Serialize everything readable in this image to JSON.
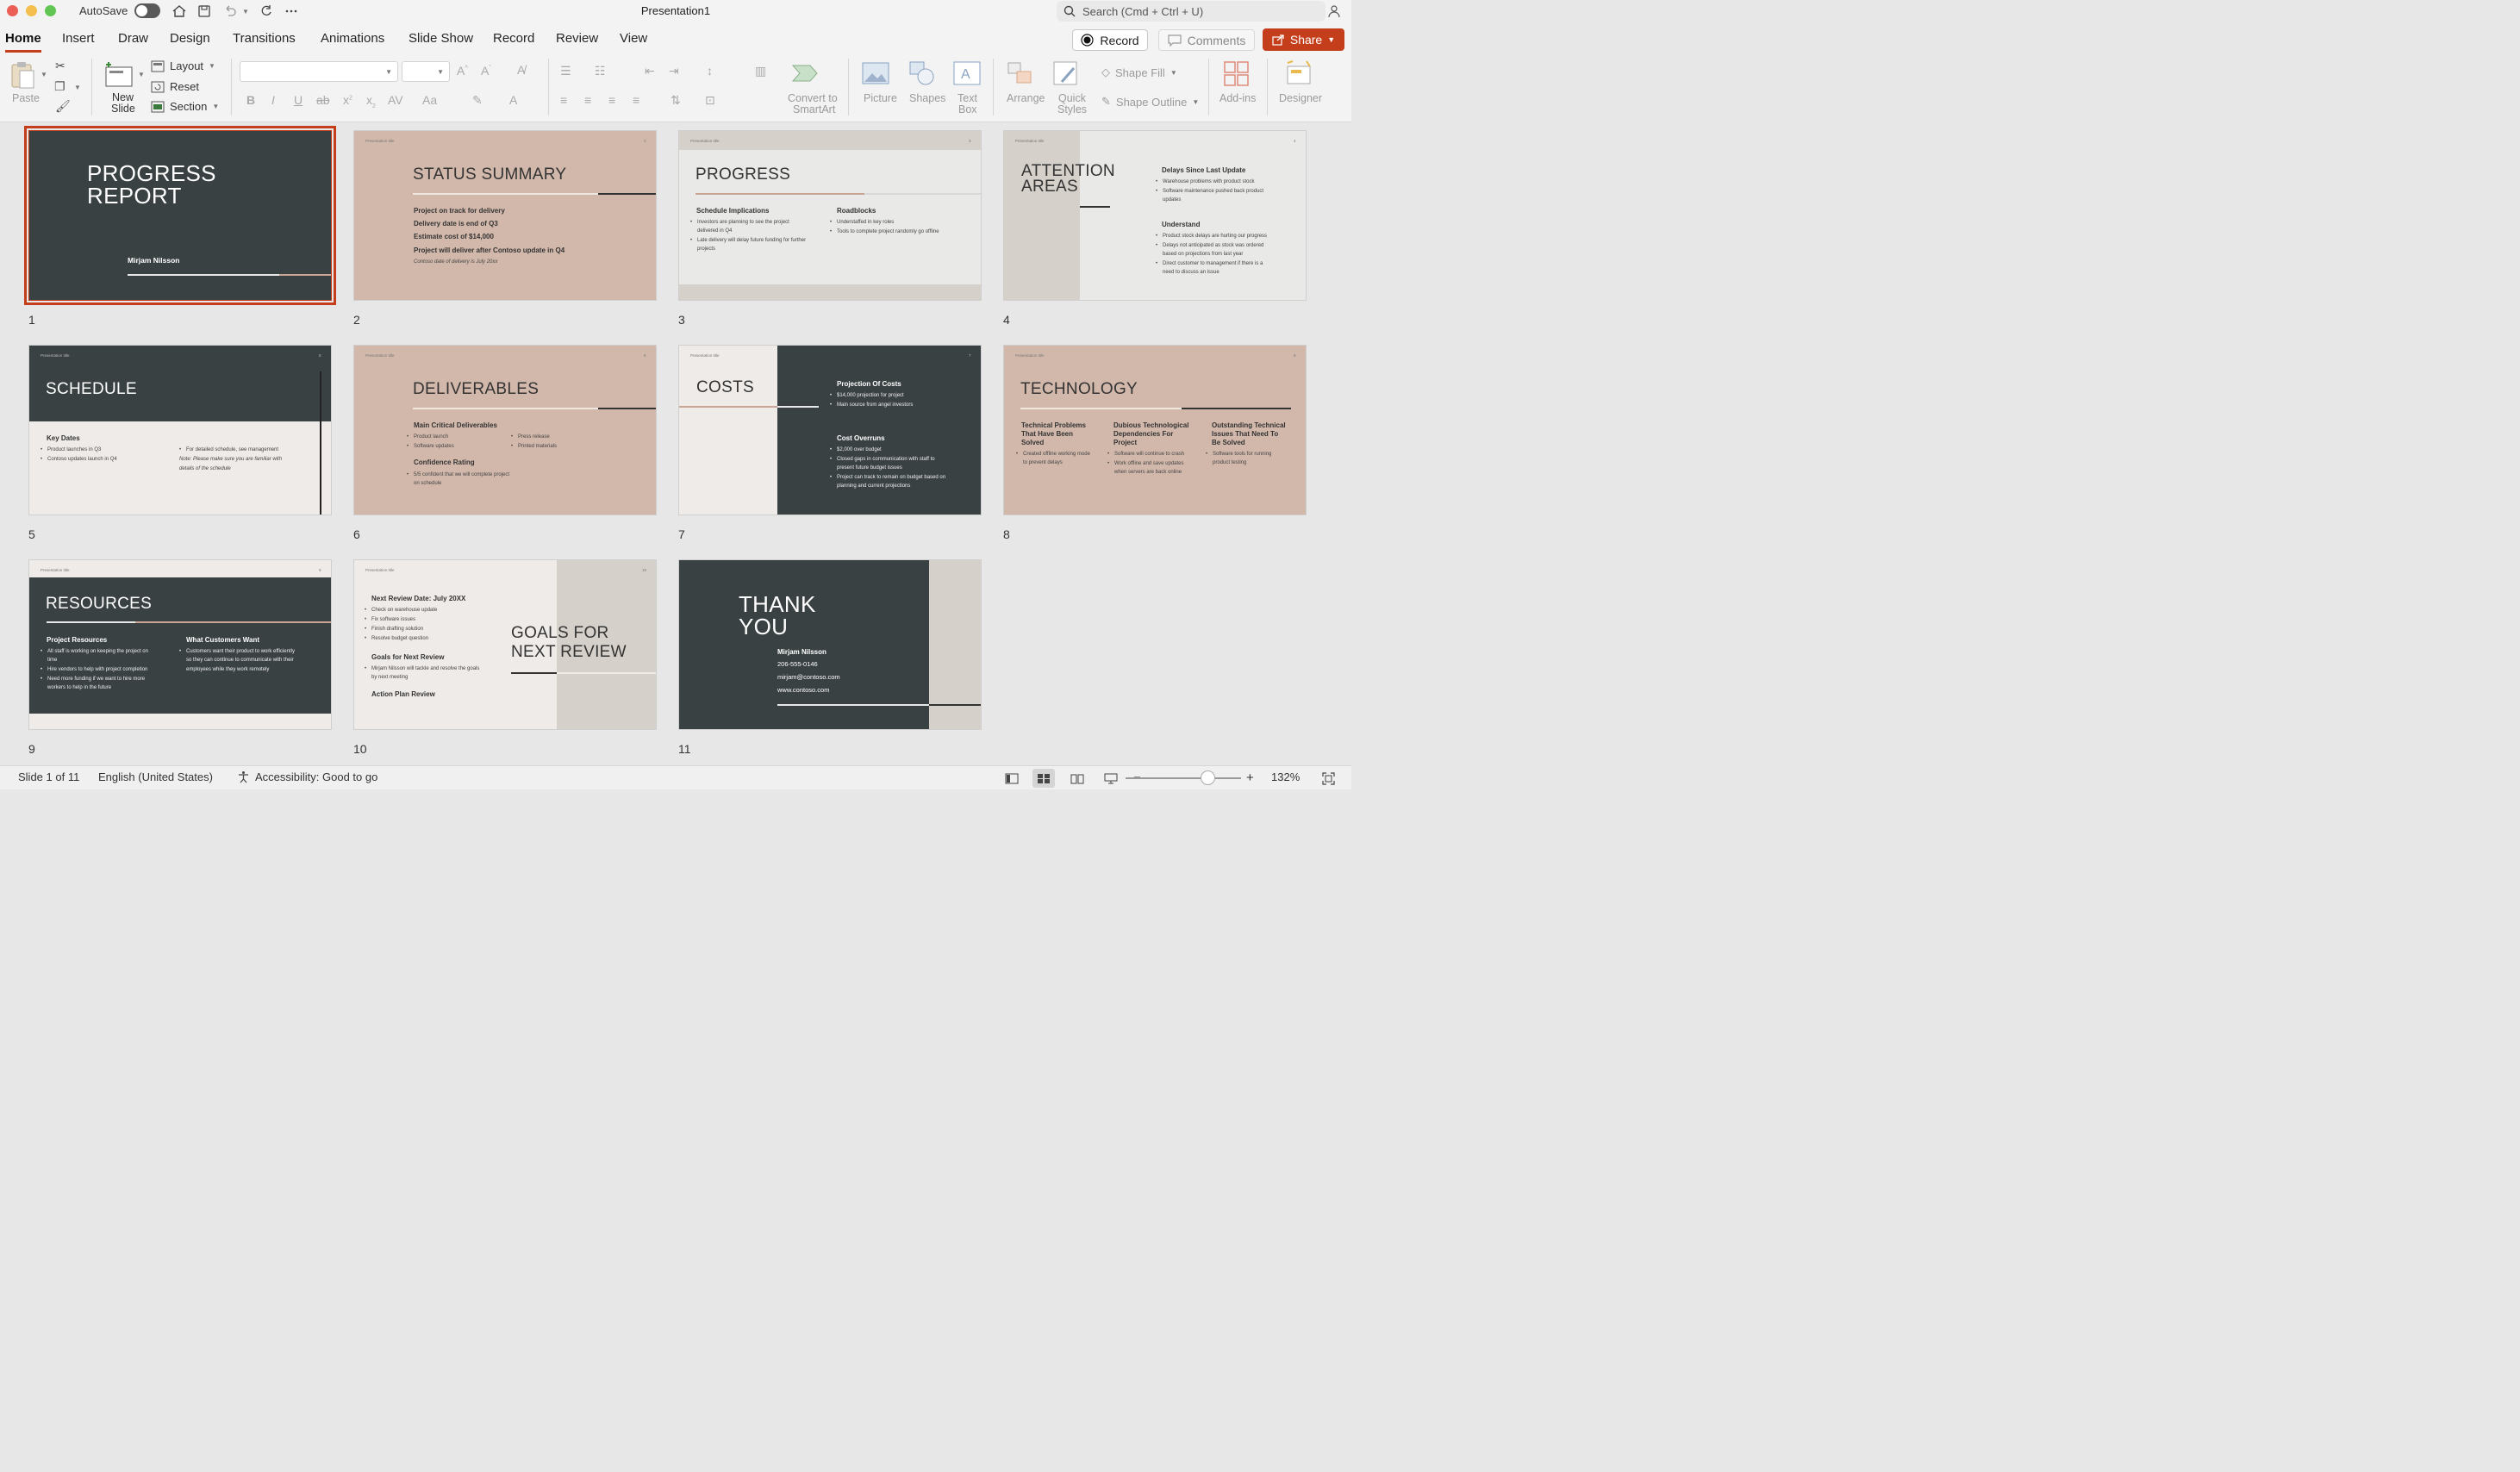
{
  "titlebar": {
    "autosave_label": "AutoSave",
    "title": "Presentation1",
    "search_placeholder": "Search (Cmd + Ctrl + U)"
  },
  "tabs": [
    "Home",
    "Insert",
    "Draw",
    "Design",
    "Transitions",
    "Animations",
    "Slide Show",
    "Record",
    "Review",
    "View"
  ],
  "actions": {
    "record": "Record",
    "comments": "Comments",
    "share": "Share"
  },
  "ribbon": {
    "paste": "Paste",
    "new_slide_1": "New",
    "new_slide_2": "Slide",
    "layout": "Layout",
    "reset": "Reset",
    "section": "Section",
    "convert_1": "Convert to",
    "convert_2": "SmartArt",
    "picture": "Picture",
    "shapes": "Shapes",
    "textbox_1": "Text",
    "textbox_2": "Box",
    "arrange": "Arrange",
    "quick_styles_1": "Quick",
    "quick_styles_2": "Styles",
    "shape_fill": "Shape Fill",
    "shape_outline": "Shape Outline",
    "addins": "Add-ins",
    "designer": "Designer"
  },
  "slides": {
    "s1": {
      "num": "1",
      "title1": "PROGRESS",
      "title2": "REPORT",
      "author": "Mirjam Nilsson"
    },
    "s2": {
      "num": "2",
      "tag": "Presentation title",
      "page": "2",
      "title": "STATUS SUMMARY",
      "l1": "Project on track for delivery",
      "l2": "Delivery date is end of Q3",
      "l3": "Estimate cost of $14,000",
      "l4": "Project will deliver after Contoso update in Q4",
      "note": "Contoso date of delivery is July 20xx"
    },
    "s3": {
      "num": "3",
      "tag": "Presentation title",
      "page": "3",
      "title": "PROGRESS",
      "h1": "Schedule Implications",
      "a1": "Investors are planning to see the project",
      "a1b": "delivered in Q4",
      "a2": "Late delivery will delay future funding for further",
      "a2b": "projects",
      "h2": "Roadblocks",
      "b1": "Understaffed in key roles",
      "b2": "Tools to complete project randomly go offline"
    },
    "s4": {
      "num": "4",
      "tag": "Presentation title",
      "page": "4",
      "title1": "ATTENTION",
      "title2": "AREAS",
      "h1": "Delays Since Last Update",
      "a1": "Warehouse problems with product stock",
      "a2": "Software maintenance pushed back product",
      "a2b": "updates",
      "h2": "Understand",
      "b1": "Product stock delays are hurting our progress",
      "b2": "Delays not anticipated as stock was ordered",
      "b2b": "based on projections from last year",
      "b3": "Direct customer to management if there is a",
      "b3b": "need to discuss an issue"
    },
    "s5": {
      "num": "5",
      "tag": "Presentation title",
      "page": "5",
      "title": "SCHEDULE",
      "h1": "Key Dates",
      "a1": "Product launches in Q3",
      "a2": "Contoso updates launch in Q4",
      "b1": "For detailed schedule, see management",
      "note1": "Note: Please make sure you are familiar with",
      "note2": "details of the schedule"
    },
    "s6": {
      "num": "6",
      "tag": "Presentation title",
      "page": "6",
      "title": "DELIVERABLES",
      "h1": "Main Critical Deliverables",
      "a1": "Product launch",
      "a2": "Software updates",
      "b1": "Press release",
      "b2": "Printed materials",
      "h2": "Confidence Rating",
      "c1": "5/5 confident that we will complete project",
      "c1b": "on schedule"
    },
    "s7": {
      "num": "7",
      "tag": "Presentation title",
      "page": "7",
      "title": "COSTS",
      "h1": "Projection Of Costs",
      "a1": "$14,000 projection for project",
      "a2": "Main source from angel investors",
      "h2": "Cost Overruns",
      "b1": "$2,000 over budget",
      "b2": "Closed gaps in communication with staff to",
      "b2b": "present future budget issues",
      "b3": "Project can track to remain on budget based on",
      "b3b": "planning and current projections"
    },
    "s8": {
      "num": "8",
      "tag": "Presentation title",
      "page": "8",
      "title": "TECHNOLOGY",
      "h1a": "Technical Problems",
      "h1b": "That Have Been",
      "h1c": "Solved",
      "a1": "Created offline working mode",
      "a1b": "to prevent delays",
      "h2a": "Dubious Technological",
      "h2b": "Dependencies For",
      "h2c": "Project",
      "b1": "Software will continue to crash",
      "b2": "Work offline and save updates",
      "b2b": "when servers are back online",
      "h3a": "Outstanding Technical",
      "h3b": "Issues That Need To",
      "h3c": "Be Solved",
      "c1": "Software tools for running",
      "c1b": "product testing"
    },
    "s9": {
      "num": "9",
      "tag": "Presentation title",
      "page": "9",
      "title": "RESOURCES",
      "h1": "Project Resources",
      "a1": "All staff is working on keeping the project on",
      "a1b": "time",
      "a2": "Hire vendors to help with project completion",
      "a3": "Need more funding if we want to hire more",
      "a3b": "workers to help in the future",
      "h2": "What Customers Want",
      "b1": "Customers want their product to work efficiently",
      "b1b": "so they can continue to communicate with their",
      "b1c": "employees while they work remotely"
    },
    "s10": {
      "num": "10",
      "tag": "Presentation title",
      "page": "10",
      "h1": "Next Review Date: July 20XX",
      "a1": "Check on warehouse update",
      "a2": "Fix software issues",
      "a3": "Finish drafting solution",
      "a4": "Resolve budget question",
      "h2": "Goals for Next Review",
      "b1": "Mirjam Nilsson will tackle and resolve the goals",
      "b1b": "by next meeting",
      "h3": "Action Plan Review",
      "title1": "GOALS FOR",
      "title2": "NEXT REVIEW"
    },
    "s11": {
      "num": "11",
      "title1": "THANK",
      "title2": "YOU",
      "name": "Mirjam Nilsson",
      "phone": "206-555-0146",
      "email": "mirjam@contoso.com",
      "web": "www.contoso.com"
    }
  },
  "statusbar": {
    "slide_info": "Slide 1 of 11",
    "language": "English (United States)",
    "accessibility": "Accessibility: Good to go",
    "zoom": "132%"
  },
  "colors": {
    "accent": "#c43e1c",
    "dark_slide": "#3a4143",
    "pink_slide": "#d2b8ab",
    "light_slide": "#e9e9e8",
    "beige": "#d5d0c9"
  }
}
